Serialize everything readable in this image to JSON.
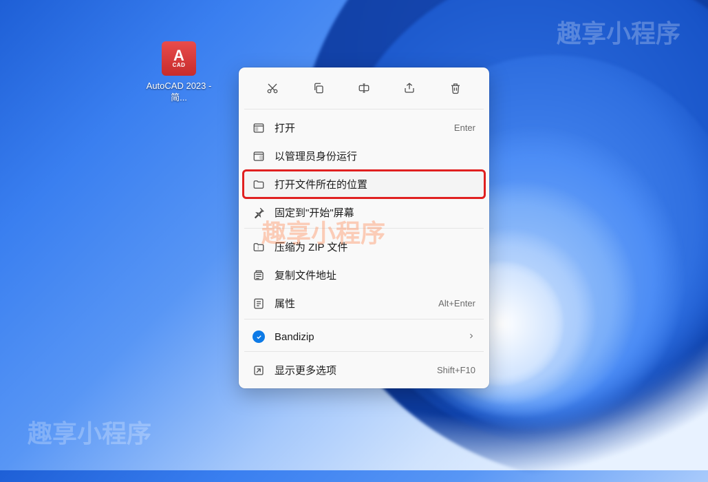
{
  "watermarks": {
    "top": "趣享小程序",
    "mid": "趣享小程序",
    "bottom": "趣享小程序"
  },
  "desktop": {
    "icon_label": "AutoCAD 2023 - 简...",
    "icon_letter": "A",
    "icon_sub": "CAD"
  },
  "menu": {
    "actions": {
      "cut": "cut",
      "copy": "copy",
      "rename": "rename",
      "share": "share",
      "delete": "delete"
    },
    "items": [
      {
        "id": "open",
        "label": "打开",
        "shortcut": "Enter",
        "icon": "window"
      },
      {
        "id": "run-admin",
        "label": "以管理员身份运行",
        "shortcut": "",
        "icon": "shield"
      },
      {
        "id": "open-location",
        "label": "打开文件所在的位置",
        "shortcut": "",
        "icon": "folder",
        "highlighted": true
      },
      {
        "id": "pin-start",
        "label": "固定到\"开始\"屏幕",
        "shortcut": "",
        "icon": "pin"
      },
      {
        "id": "compress-zip",
        "label": "压缩为 ZIP 文件",
        "shortcut": "",
        "icon": "zip"
      },
      {
        "id": "copy-path",
        "label": "复制文件地址",
        "shortcut": "",
        "icon": "copypath"
      },
      {
        "id": "properties",
        "label": "属性",
        "shortcut": "Alt+Enter",
        "icon": "properties"
      },
      {
        "id": "bandizip",
        "label": "Bandizip",
        "shortcut": "",
        "icon": "bandizip",
        "submenu": true
      },
      {
        "id": "show-more",
        "label": "显示更多选项",
        "shortcut": "Shift+F10",
        "icon": "expand"
      }
    ]
  }
}
